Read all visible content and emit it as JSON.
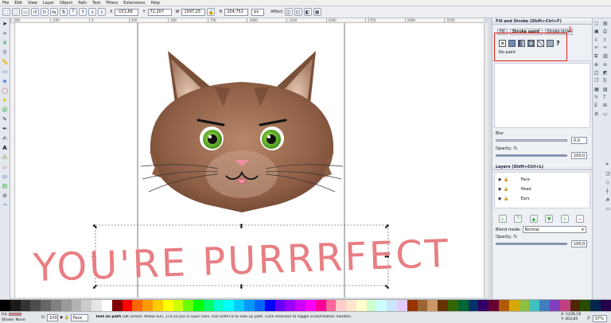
{
  "menu": [
    "File",
    "Edit",
    "View",
    "Layer",
    "Object",
    "Path",
    "Text",
    "Filters",
    "Extensions",
    "Help"
  ],
  "controls": {
    "x_label": "X",
    "x_value": "-151,89",
    "y_label": "Y",
    "y_value": "72,207",
    "w_label": "W",
    "w_value": "1097,25",
    "h_label": "H",
    "h_value": "204,752",
    "unit": "px",
    "affect_label": "Affect:"
  },
  "ruler_ticks": [
    "-500",
    "-250",
    "0",
    "250",
    "500",
    "750",
    "1000",
    "1250",
    "1500",
    "1750",
    "2000",
    "2250"
  ],
  "canvas": {
    "text_on_path": "YOU'RE PURRRFECT",
    "text_color": "#e87e83"
  },
  "panel": {
    "fill_stroke_title": "Fill and Stroke (Shift+Ctrl+F)",
    "tabs": [
      "Fill",
      "Stroke paint",
      "Stroke style"
    ],
    "annotation_number": "1",
    "help_glyph": "?",
    "no_paint_label": "No paint",
    "blur_label": "Blur",
    "blur_value": "0,0",
    "opacity_label": "Opacity, %",
    "opacity_value": "100,0",
    "layers_title": "Layers (Shift+Ctrl+L)",
    "layers": [
      "Face",
      "Head",
      "Ears"
    ],
    "blend_label": "Blend mode:",
    "blend_value": "Normal",
    "layer_opacity_label": "Opacity, %",
    "layer_opacity_value": "100,0"
  },
  "status": {
    "fill_label": "Fill:",
    "stroke_label": "Stroke:",
    "stroke_value": "None",
    "fill_color": "#e87e83",
    "o_label": "O:",
    "o_value": "100",
    "layer_value": "Face",
    "message_strong": "Text on path",
    "message": "(DK Lemon Yellow Sun, 174,55 px) in layer Face. Use Shift+D to look up path. Click selection to toggle scale/rotation handles.",
    "xcoord": "X: 1236,18",
    "ycoord": "Y: 403,85",
    "zoom_label": "Z:",
    "zoom_value": "37%"
  },
  "palette_colors": [
    "#000000",
    "#1a1a1a",
    "#333333",
    "#4d4d4d",
    "#666666",
    "#808080",
    "#999999",
    "#b3b3b3",
    "#cccccc",
    "#e6e6e6",
    "#ffffff",
    "#800000",
    "#ff0000",
    "#ff6600",
    "#ff9900",
    "#ffcc00",
    "#ffff00",
    "#ccff00",
    "#66ff00",
    "#00ff00",
    "#00ff66",
    "#00ffcc",
    "#00ffff",
    "#00ccff",
    "#0099ff",
    "#0066ff",
    "#0000ff",
    "#6600ff",
    "#9900ff",
    "#cc00ff",
    "#ff00ff",
    "#ff0099",
    "#ff6699",
    "#ffcccc",
    "#ffe5cc",
    "#ffffcc",
    "#ccffcc",
    "#ccffff",
    "#cce5ff",
    "#e5ccff",
    "#993300",
    "#996633",
    "#cc9966",
    "#663300",
    "#336600",
    "#006633",
    "#003366",
    "#330066",
    "#660033",
    "#b35900",
    "#d4aa00",
    "#8fbf3f",
    "#3fbfbf",
    "#3f7fbf",
    "#7f3fbf",
    "#bf3f7f",
    "#4d2600",
    "#264d00",
    "#00264d",
    "#26004d"
  ]
}
